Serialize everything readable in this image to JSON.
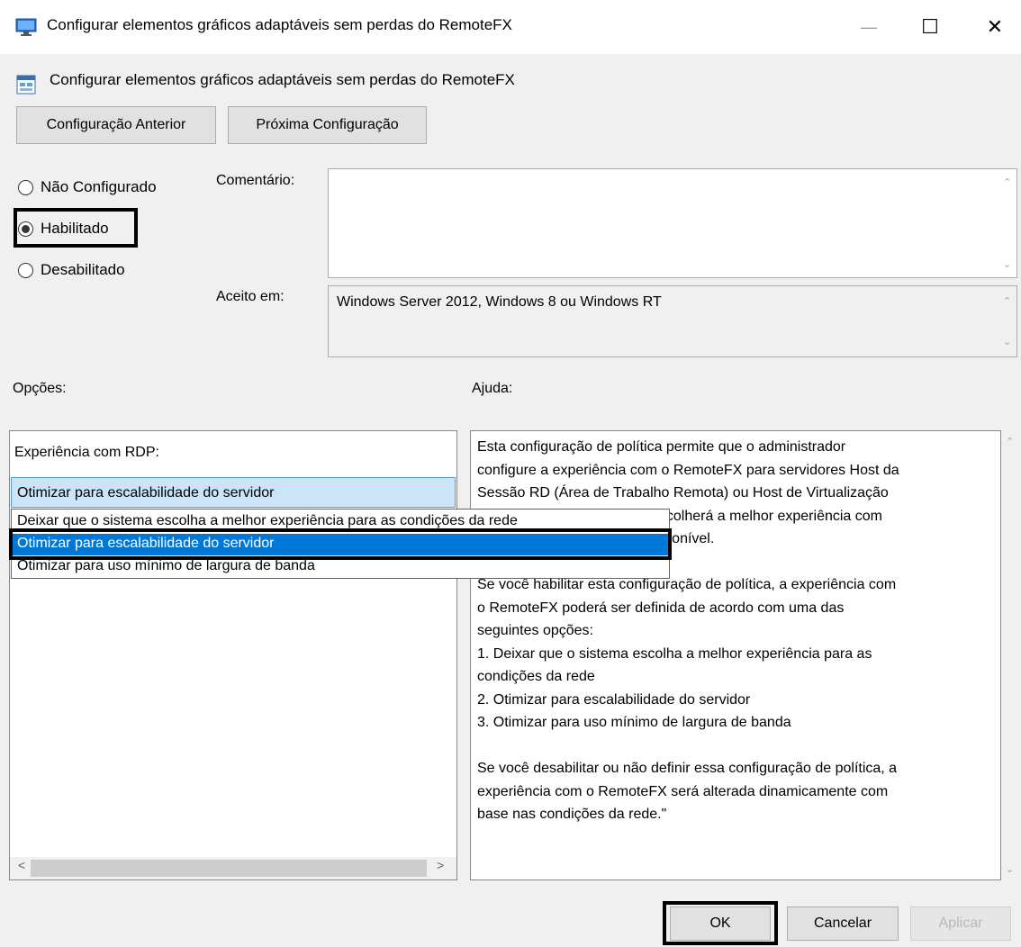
{
  "window": {
    "title": "Configurar elementos gráficos adaptáveis sem perdas do RemoteFX",
    "minimize": "—",
    "maximize": "☐",
    "close": "✕",
    "app_icon": "remote-desktop-icon"
  },
  "header": {
    "policy_title": "Configurar elementos gráficos adaptáveis sem perdas do RemoteFX",
    "policy_icon": "policy-setting-icon",
    "prev_button": "Configuração Anterior",
    "next_button": "Próxima Configuração"
  },
  "state": {
    "options": [
      {
        "label": "Não Configurado",
        "checked": false
      },
      {
        "label": "Habilitado",
        "checked": true
      },
      {
        "label": "Desabilitado",
        "checked": false
      }
    ]
  },
  "comment": {
    "label": "Comentário:",
    "value": ""
  },
  "supported": {
    "label": "Aceito em:",
    "value": "Windows Server 2012, Windows 8 ou Windows RT"
  },
  "options_panel": {
    "heading": "Opções:",
    "field_label": "Experiência com RDP:",
    "selected_value": "Otimizar para escalabilidade do servidor",
    "dropdown_items": [
      "Deixar que o sistema escolha a melhor experiência para as condições da rede",
      "Otimizar para escalabilidade do servidor",
      "Otimizar para uso mínimo de largura de banda"
    ],
    "highlighted_index": 1
  },
  "help_panel": {
    "heading": "Ajuda:",
    "text": "Esta configuração de política permite que o administrador\nconfigure a experiência com o RemoteFX para servidores Host da\nSessão RD (Área de Trabalho Remota) ou Host de Virtualização\nRD. Por padrão, o sistema escolherá a melhor experiência com\nbase na largura de banda disponível.\n\nSe você habilitar esta configuração de política, a experiência com\no RemoteFX poderá ser definida de acordo com uma das\nseguintes opções:\n1. Deixar que o sistema escolha a melhor experiência para as\ncondições da rede\n2. Otimizar para escalabilidade do servidor\n3. Otimizar para uso mínimo de largura de banda\n\nSe você desabilitar ou não definir essa configuração de política, a\nexperiência com o RemoteFX será alterada dinamicamente com\nbase nas condições da rede.\""
  },
  "footer": {
    "ok": "OK",
    "cancel": "Cancelar",
    "apply": "Aplicar"
  },
  "colors": {
    "selection": "#0078d7",
    "combo_bg": "#cce4f7",
    "highlight_outline": "#000000"
  }
}
